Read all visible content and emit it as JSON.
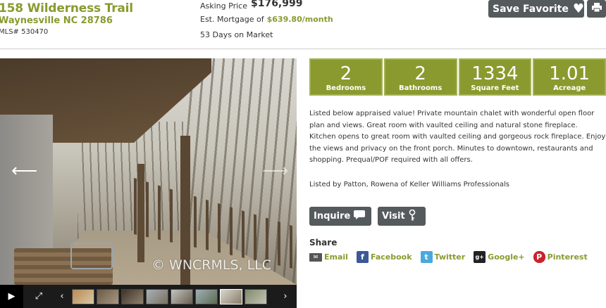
{
  "header": {
    "street": "158 Wilderness Trail",
    "city": "Waynesville NC 28786",
    "mls": "MLS# 530470"
  },
  "pricing": {
    "asking_label": "Asking Price",
    "asking_value": "$176,999",
    "mortgage_label": "Est. Mortgage of",
    "mortgage_value": "$639.80/month",
    "days_on_market": "53 Days on Market"
  },
  "toolbar": {
    "save_label": "Save Favorite",
    "save_icon": "heart-icon",
    "print_icon": "print-icon"
  },
  "gallery": {
    "watermark": "© WNCRMLS, LLC",
    "thumb_count": 8,
    "active_thumb_index": 6
  },
  "stats": [
    {
      "value": "2",
      "label": "Bedrooms"
    },
    {
      "value": "2",
      "label": "Bathrooms"
    },
    {
      "value": "1334",
      "label": "Square Feet"
    },
    {
      "value": "1.01",
      "label": "Acreage"
    }
  ],
  "description": "Listed below appraised value! Private mountain chalet with wonderful open floor plan and views. Great room with vaulted ceiling and natural stone fireplace. Kitchen opens to great room with vaulted ceiling and gorgeous rock fireplace. Enjoy the views and privacy on the front porch. Minutes to downtown, restaurants and shopping. Prequal/POF required with all offers.",
  "listed_by": "Listed by Patton, Rowena of Keller Williams Professionals",
  "actions": {
    "inquire_label": "Inquire",
    "visit_label": "Visit"
  },
  "share": {
    "title": "Share",
    "email": "Email",
    "facebook": "Facebook",
    "twitter": "Twitter",
    "google": "Google+",
    "pinterest": "Pinterest"
  },
  "colors": {
    "accent": "#8a9a2e",
    "button": "#555a5c"
  }
}
